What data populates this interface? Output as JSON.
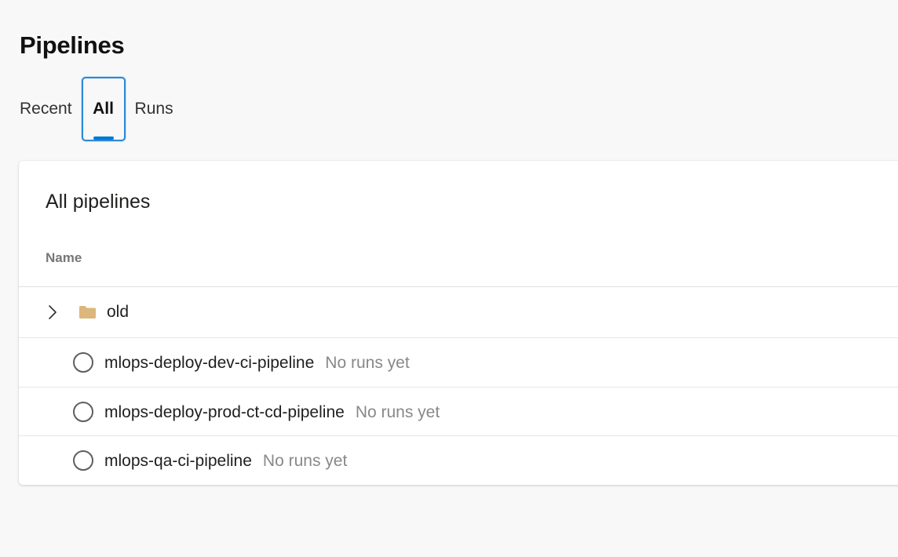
{
  "page": {
    "title": "Pipelines"
  },
  "tabs": [
    {
      "label": "Recent",
      "selected": false
    },
    {
      "label": "All",
      "selected": true
    },
    {
      "label": "Runs",
      "selected": false
    }
  ],
  "card": {
    "title": "All pipelines",
    "column_header": "Name",
    "folder": {
      "name": "old",
      "icon": "folder-icon",
      "expand_icon": "chevron-right-icon"
    },
    "pipelines": [
      {
        "name": "mlops-deploy-dev-ci-pipeline",
        "status": "No runs yet",
        "icon": "empty-circle-status-icon"
      },
      {
        "name": "mlops-deploy-prod-ct-cd-pipeline",
        "status": "No runs yet",
        "icon": "empty-circle-status-icon"
      },
      {
        "name": "mlops-qa-ci-pipeline",
        "status": "No runs yet",
        "icon": "empty-circle-status-icon"
      }
    ]
  },
  "colors": {
    "accent": "#0078d4",
    "folder": "#dcb67a",
    "muted_text": "#8a8886",
    "background": "#f8f8f8"
  }
}
